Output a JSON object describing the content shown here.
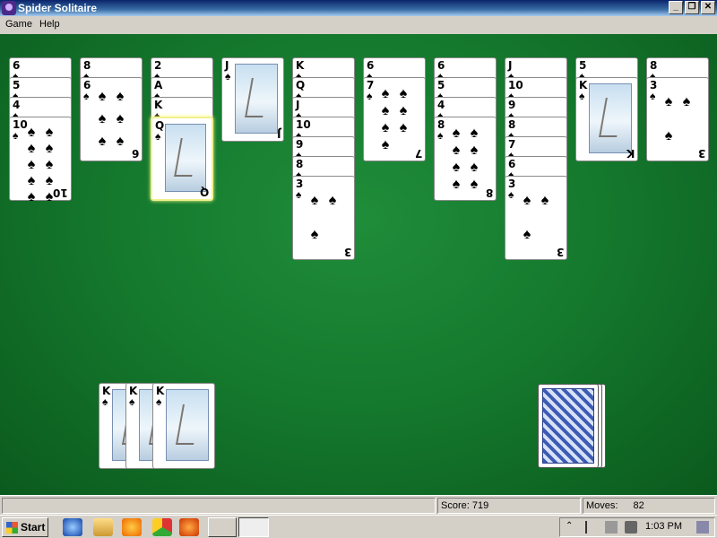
{
  "window": {
    "title": "Spider Solitaire",
    "minimize": "_",
    "restore": "❐",
    "close": "✕"
  },
  "menu": {
    "game": "Game",
    "help": "Help"
  },
  "status": {
    "score_label": "Score: 719",
    "moves_label": "Moves:",
    "moves_value": "82"
  },
  "taskbar": {
    "start": "Start",
    "clock": "1:03 PM"
  },
  "suit": "♠",
  "tableau": [
    [
      {
        "rank": "6"
      },
      {
        "rank": "5"
      },
      {
        "rank": "4"
      },
      {
        "rank": "10",
        "face": true
      }
    ],
    [
      {
        "rank": "8"
      },
      {
        "rank": "6",
        "face": true
      }
    ],
    [
      {
        "rank": "2"
      },
      {
        "rank": "A"
      },
      {
        "rank": "K"
      },
      {
        "rank": "Q",
        "face": true,
        "highlight": true
      }
    ],
    [
      {
        "rank": "J",
        "face": true
      }
    ],
    [
      {
        "rank": "K"
      },
      {
        "rank": "Q"
      },
      {
        "rank": "J"
      },
      {
        "rank": "10"
      },
      {
        "rank": "9"
      },
      {
        "rank": "8"
      },
      {
        "rank": "3",
        "face": true
      }
    ],
    [
      {
        "rank": "6"
      },
      {
        "rank": "7",
        "face": true
      }
    ],
    [
      {
        "rank": "6"
      },
      {
        "rank": "5"
      },
      {
        "rank": "4"
      },
      {
        "rank": "8",
        "face": true
      }
    ],
    [
      {
        "rank": "J"
      },
      {
        "rank": "10"
      },
      {
        "rank": "9"
      },
      {
        "rank": "8"
      },
      {
        "rank": "7"
      },
      {
        "rank": "6"
      },
      {
        "rank": "3",
        "face": true
      }
    ],
    [
      {
        "rank": "5"
      },
      {
        "rank": "K",
        "face": true
      }
    ],
    [
      {
        "rank": "8"
      },
      {
        "rank": "3",
        "face": true
      }
    ]
  ],
  "completed": [
    {
      "rank": "K"
    },
    {
      "rank": "K"
    },
    {
      "rank": "K"
    }
  ],
  "stock_piles": 3
}
